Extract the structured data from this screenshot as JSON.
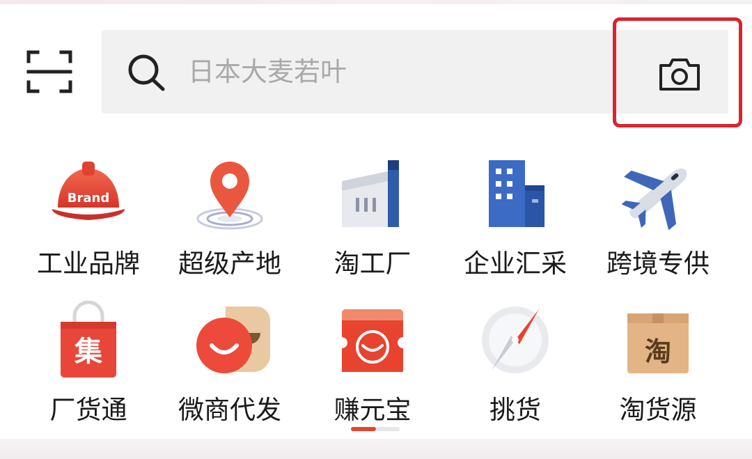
{
  "search": {
    "placeholder": "日本大麦若叶",
    "value": ""
  },
  "colors": {
    "accent_red": "#d9252f",
    "pager_active": "#e3452d",
    "text": "#1a1a1a",
    "placeholder": "#a9a9a9"
  },
  "icons": {
    "scan": "scan-icon",
    "search": "search-icon",
    "camera": "camera-icon"
  },
  "categories": [
    {
      "label": "工业品牌",
      "icon": "brand-helmet-icon",
      "icon_text": "Brand"
    },
    {
      "label": "超级产地",
      "icon": "location-pin-icon"
    },
    {
      "label": "淘工厂",
      "icon": "factory-icon"
    },
    {
      "label": "企业汇采",
      "icon": "office-building-icon"
    },
    {
      "label": "跨境专供",
      "icon": "airplane-icon"
    },
    {
      "label": "厂货通",
      "icon": "shopping-bag-icon",
      "icon_text": "集"
    },
    {
      "label": "微商代发",
      "icon": "smile-chat-icon"
    },
    {
      "label": "赚元宝",
      "icon": "gold-ingot-ticket-icon"
    },
    {
      "label": "挑货",
      "icon": "compass-icon"
    },
    {
      "label": "淘货源",
      "icon": "package-box-icon",
      "icon_text": "淘"
    }
  ],
  "pager": {
    "current": 1,
    "total": 2
  }
}
